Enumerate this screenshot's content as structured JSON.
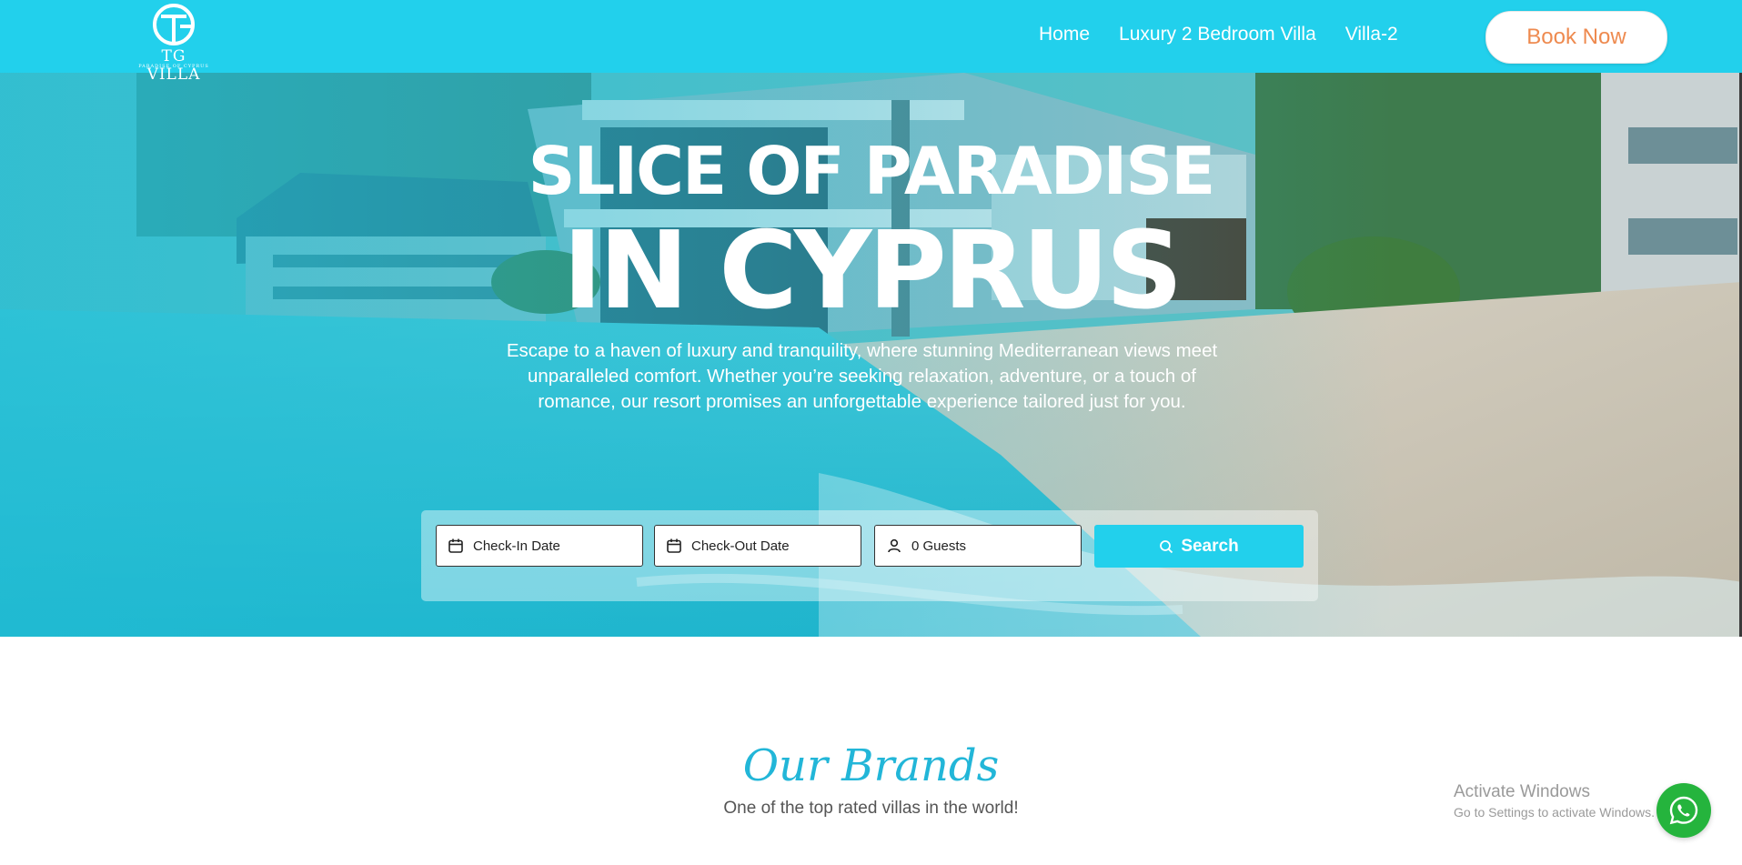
{
  "header": {
    "logo_text": "TG VILLA",
    "logo_tagline": "PARADISE OF CYPRUS",
    "nav": [
      {
        "label": "Home"
      },
      {
        "label": "Luxury 2 Bedroom Villa"
      },
      {
        "label": "Villa-2"
      }
    ],
    "book_now": "Book Now"
  },
  "hero": {
    "title_line1": "SLICE OF PARADISE",
    "title_line2": "IN CYPRUS",
    "description": "Escape to a haven of luxury and tranquility, where stunning Mediterranean views meet unparalleled comfort. Whether you’re seeking relaxation, adventure, or a touch of romance, our resort promises an unforgettable experience tailored just for you."
  },
  "booking": {
    "check_in": "Check-In Date",
    "check_out": "Check-Out Date",
    "guests": "0 Guests",
    "search": "Search"
  },
  "brands": {
    "title": "Our Brands",
    "subtitle": "One of the top rated villas in the world!"
  },
  "windows_watermark": {
    "line1": "Activate Windows",
    "line2": "Go to Settings to activate Windows."
  },
  "icons": {
    "calendar": "calendar-icon",
    "user": "user-icon",
    "search": "search-icon",
    "whatsapp": "whatsapp-icon"
  },
  "colors": {
    "brand_cyan": "#22d0ec",
    "book_now_text": "#ee8a4f",
    "brands_title": "#22b6d8",
    "whatsapp_green": "#25b43d"
  }
}
